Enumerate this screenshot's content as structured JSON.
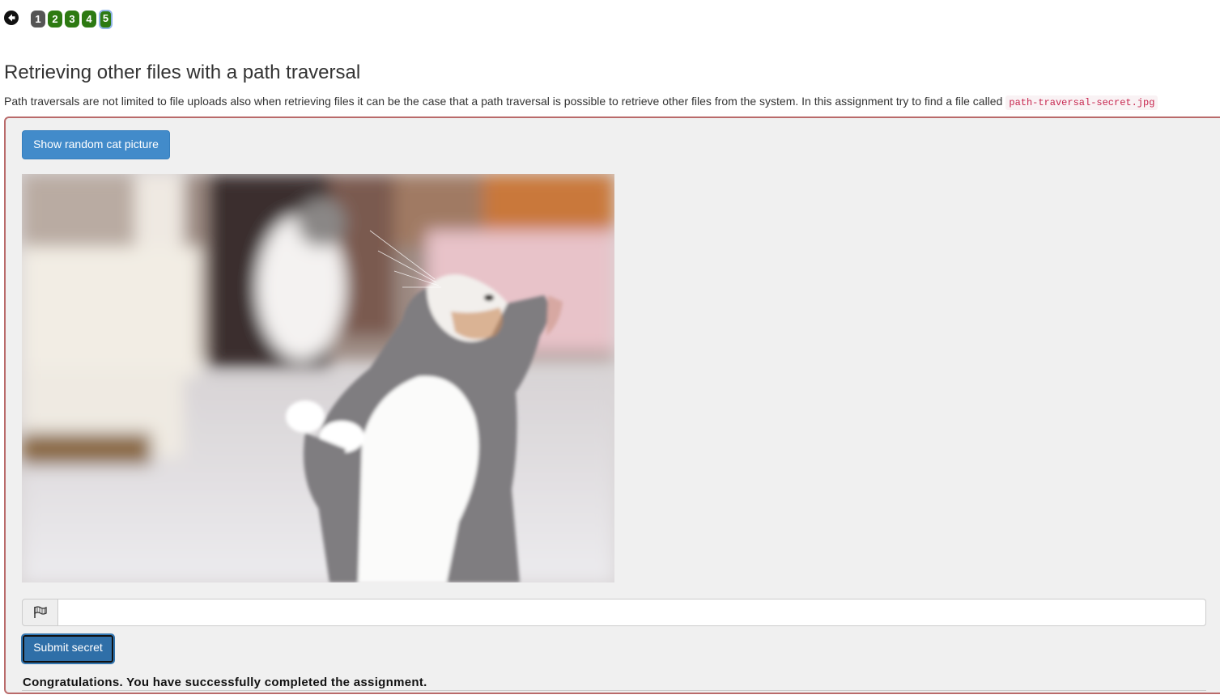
{
  "nav": {
    "back_icon": "circle-arrow-left-icon",
    "pages": [
      {
        "label": "1",
        "color": "#555555"
      },
      {
        "label": "2",
        "color": "#2d7a12"
      },
      {
        "label": "3",
        "color": "#2d7a12"
      },
      {
        "label": "4",
        "color": "#2d7a12"
      },
      {
        "label": "5",
        "color": "#2d7a12",
        "current": true
      }
    ]
  },
  "lesson": {
    "title": "Retrieving other files with a path traversal",
    "description": "Path traversals are not limited to file uploads also when retrieving files it can be the case that a path traversal is possible to retrieve other files from the system. In this assignment try to find a file called",
    "filename": "path-traversal-secret.jpg"
  },
  "assignment": {
    "show_button_label": "Show random cat picture",
    "image_icon": "cat-photo",
    "flag_icon": "flag-icon",
    "secret_value": "",
    "submit_label": "Submit secret",
    "feedback": "Congratulations. You have successfully completed the assignment."
  },
  "colors": {
    "primary": "#428bca",
    "success_page": "#2d7a12",
    "panel_border": "#b96a6a",
    "code_text": "#c7254e"
  }
}
